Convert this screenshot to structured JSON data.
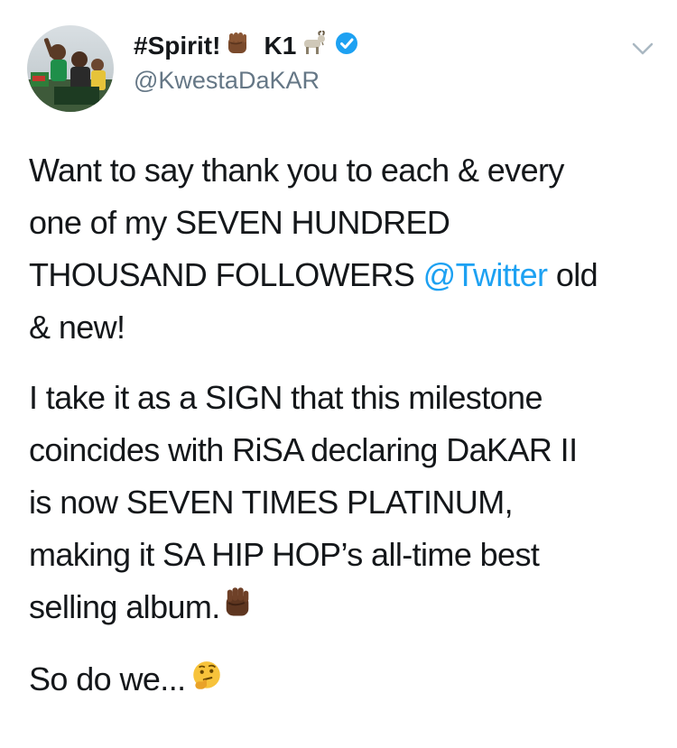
{
  "author": {
    "display_name_part1": "#Spirit!",
    "display_name_part2": "K1",
    "handle": "@KwestaDaKAR",
    "verified": true,
    "verified_color": "#1da1f2"
  },
  "icons": {
    "avatar": "avatar-photo",
    "emoji_1": "raised-fist-dark-skin",
    "emoji_2": "goat",
    "badge": "verified-badge",
    "menu": "chevron-down",
    "emoji_end_para2": "raised-fist-dark-skin",
    "emoji_end_para3": "thinking-face"
  },
  "tweet": {
    "para1": {
      "line1": "Want to say thank you to each & every",
      "line2": "one of my SEVEN HUNDRED",
      "line3_pre": "THOUSAND FOLLOWERS ",
      "line3_mention": "@Twitter",
      "line3_post": " old",
      "line4": "& new!"
    },
    "para2": {
      "line1": "I take it as a SIGN that this milestone",
      "line2": "coincides with RiSA declaring DaKAR II",
      "line3": "is now SEVEN TIMES PLATINUM,",
      "line4": "making it SA HIP HOP’s all-time best",
      "line5": "selling album."
    },
    "para3": {
      "line1": "So do we..."
    }
  },
  "colors": {
    "text": "#14171a",
    "secondary": "#657786",
    "link": "#1da1f2"
  }
}
